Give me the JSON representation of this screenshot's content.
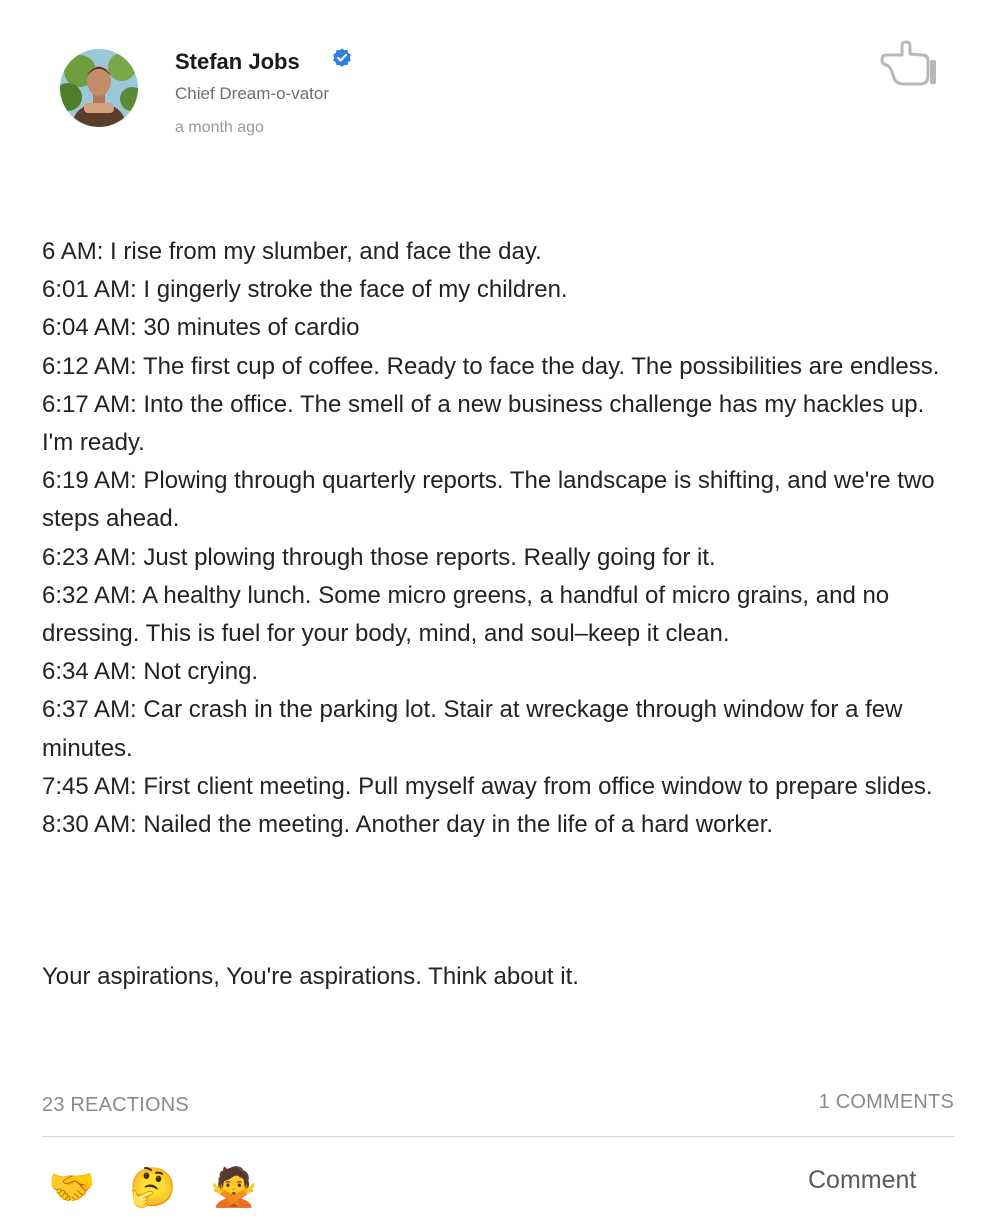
{
  "author": {
    "name": "Stefan Jobs",
    "title": "Chief Dream-o-vator",
    "posted": "a month ago",
    "verified": true,
    "avatar_icon": "person-portrait",
    "verified_color": "#2f7de1"
  },
  "post": {
    "lines": [
      "6 AM: I rise from my slumber, and face the day.",
      "6:01 AM: I gingerly stroke the face of my children.",
      "6:04 AM: 30 minutes of cardio",
      "6:12 AM: The first cup of coffee. Ready to face the day. The possibilities are endless.",
      "6:17 AM: Into the office. The smell of a new business challenge has my hackles up. I'm ready.",
      "6:19 AM: Plowing through quarterly reports. The landscape is shifting, and we're two steps ahead.",
      "6:23 AM: Just plowing through those reports. Really going for it.",
      "6:32 AM: A healthy lunch. Some micro greens, a handful of micro grains, and no dressing. This is fuel for your body, mind, and soul–keep it clean.",
      "6:34 AM: Not crying.",
      "6:37 AM: Car crash in the parking lot. Stair at wreckage through window for a few minutes.",
      "7:45 AM: First client meeting. Pull myself away from office window to prepare slides.",
      "8:30 AM: Nailed the meeting. Another day in the life of a hard worker."
    ],
    "closing": "Your aspirations, You're aspirations. Think about it."
  },
  "footer": {
    "reactions_label": "23 REACTIONS",
    "comments_label": "1 COMMENTS",
    "comment_button": "Comment",
    "reactions": [
      {
        "emoji": "🤝",
        "icon": "handshake-icon"
      },
      {
        "emoji": "🤔",
        "icon": "thinking-face-icon"
      },
      {
        "emoji": "🙅",
        "icon": "gesturing-no-icon"
      }
    ]
  },
  "icons": {
    "menu": "pointing-hand-icon"
  }
}
